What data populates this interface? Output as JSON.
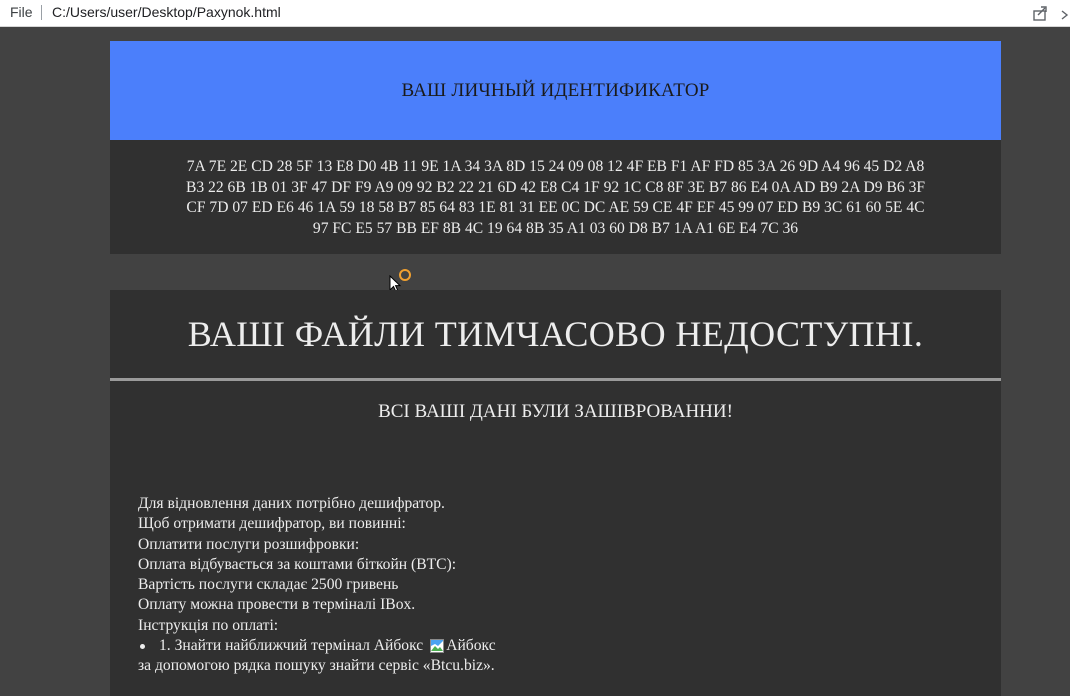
{
  "browser": {
    "file_label": "File",
    "url": "C:/Users/user/Desktop/Paxynok.html"
  },
  "id_panel": {
    "header": "ВАШ ЛИЧНЫЙ ИДЕНТИФИКАТОР",
    "lines": [
      "7A 7E 2E CD 28 5F 13 E8 D0 4B 11 9E 1A 34 3A 8D 15 24 09 08 12 4F EB F1 AF FD 85 3A 26 9D A4 96 45 D2 A8",
      "B3 22 6B 1B 01 3F 47 DF F9 A9 09 92 B2 22 21 6D 42 E8 C4 1F 92 1C C8 8F 3E B7 86 E4 0A AD B9 2A D9 B6 3F",
      "CF 7D 07 ED E6 46 1A 59 18 58 B7 85 64 83 1E 81 31 EE 0C DC AE 59 CE 4F EF 45 99 07 ED B9 3C 61 60 5E 4C",
      "97 FC E5 57 BB EF 8B 4C 19 64 8B 35 A1 03 60 D8 B7 1A A1 6E E4 7C 36"
    ]
  },
  "main_panel": {
    "title": "ВАШІ ФАЙЛИ ТИМЧАСОВО НЕДОСТУПНІ.",
    "subtitle": "ВСІ ВАШІ ДАНІ БУЛИ ЗАШІВРОВАННИ!",
    "lines": [
      "Для відновлення даних потрібно дешифратор.",
      "Щоб отримати дешифратор, ви повинні:",
      "Оплатити послуги розшифровки:",
      "Оплата відбувається за коштами біткойн (BTC):",
      "Вартість послуги складає 2500 гривень",
      "Оплату можна провести в терміналі IBox.",
      "Інструкція по оплаті:"
    ],
    "bullet_text": "1. Знайти найближчий термінал Айбокс",
    "image_alt": "Айбокс",
    "after_bullet": "за допомогою рядка пошуку знайти сервіс «Btcu.biz»."
  },
  "colors": {
    "page_bg": "#424242",
    "panel_bg": "#303030",
    "header_blue": "#4b7ffb",
    "text": "#ededed"
  },
  "icons": [
    "share-icon",
    "more-icon",
    "mouse-cursor-icon",
    "busy-ring-icon",
    "broken-image-icon"
  ]
}
